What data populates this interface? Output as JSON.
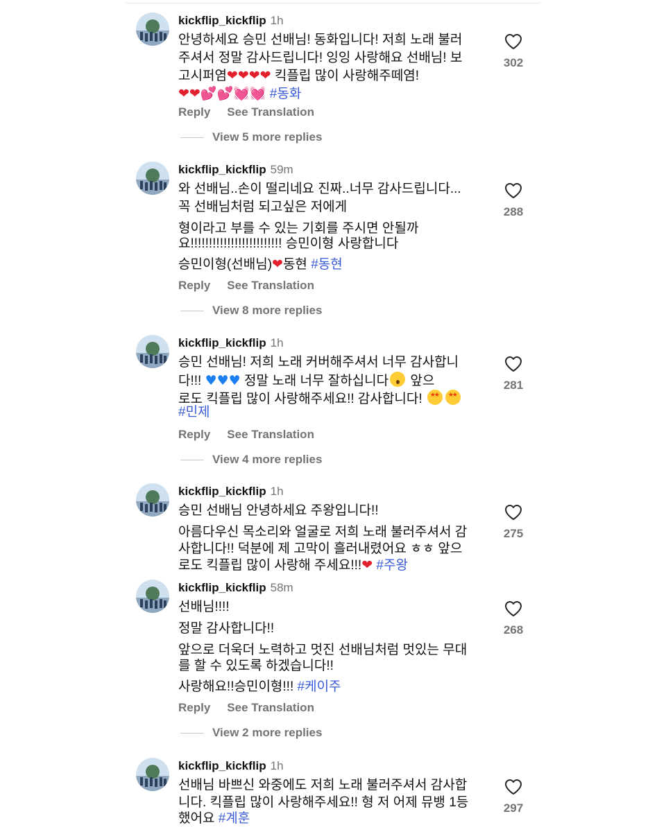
{
  "reply_label": "Reply",
  "translate_label": "See Translation",
  "comments": [
    {
      "username": "kickflip_kickflip",
      "time": "1h",
      "lines": [
        "안녕하세요 승민 선배님! 동화입니다! 저희 노래 불러",
        "주셔서 정말 감사드립니다! 잉잉 사랑해요 선배님! 보",
        "고시퍼염",
        "킥플립 많이 사랑해주떼염!",
        "#동화"
      ],
      "likes": "302",
      "view_more": "View 5 more replies"
    },
    {
      "username": "kickflip_kickflip",
      "time": "59m",
      "lines": [
        "와 선배님..손이 떨리네요 진짜..너무 감사드립니다...",
        "꼭 선배님처럼 되고싶은 저에게",
        "형이라고 부를 수 있는 기회를 주시면 안될까",
        "요!!!!!!!!!!!!!!!!!!!!!!!!! 승민이형 사랑합니다",
        "승민이형(선배님)",
        "동현",
        "#동현"
      ],
      "likes": "288",
      "view_more": "View 8 more replies"
    },
    {
      "username": "kickflip_kickflip",
      "time": "1h",
      "lines": [
        "승민 선배님! 저희 노래 커버해주셔서 너무 감사합니",
        "다!!!",
        "정말 노래 너무 잘하십니다",
        "앞으",
        "로도 킥플립 많이 사랑해주세요!! 감사합니다!",
        "#민제"
      ],
      "likes": "281",
      "view_more": "View 4 more replies"
    },
    {
      "username": "kickflip_kickflip",
      "time": "1h",
      "lines": [
        "승민 선배님 안녕하세요 주왕입니다!!",
        "아름다우신 목소리와 얼굴로 저희 노래 불러주셔서 감",
        "사합니다!! 덕분에 제 고막이 흘러내렸어요 ㅎㅎ 앞으",
        "로도 킥플립 많이 사랑해 주세요!!!",
        "#주왕"
      ],
      "likes": "275"
    },
    {
      "username": "kickflip_kickflip",
      "time": "58m",
      "lines": [
        "선배님!!!!",
        "정말 감사합니다!!",
        "앞으로 더욱더 노력하고 멋진 선배님처럼 멋있는 무대",
        "를 할 수 있도록 하겠습니다!!",
        "사랑해요!!승민이형!!!",
        "#케이주"
      ],
      "likes": "268",
      "view_more": "View 2 more replies"
    },
    {
      "username": "kickflip_kickflip",
      "time": "1h",
      "lines": [
        "선배님 바쁘신 와중에도 저희 노래 불러주셔서 감사합",
        "니다. 킥플립 많이 사랑해주세요!! 형 저 어제 뮤뱅 1등",
        "했어요",
        "#계훈"
      ],
      "likes": "297"
    }
  ],
  "icons": {
    "like": "heart-outline-icon",
    "avatar": "profile-photo"
  },
  "colors": {
    "hashtag": "#3a5bd9",
    "meta": "#737373",
    "heart_red": "#e4202e"
  }
}
